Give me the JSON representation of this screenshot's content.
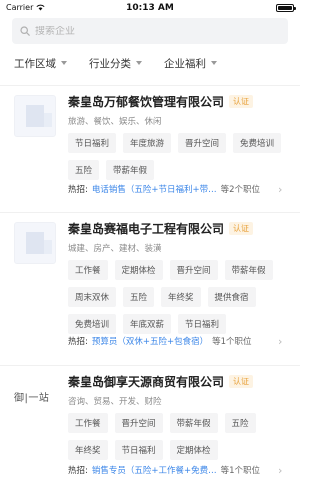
{
  "status_bar": {
    "carrier": "Carrier",
    "time": "10:13 AM"
  },
  "search": {
    "placeholder": "搜索企业"
  },
  "filters": [
    {
      "label": "工作区域"
    },
    {
      "label": "行业分类"
    },
    {
      "label": "企业福利"
    }
  ],
  "companies": [
    {
      "name": "秦皇岛万郁餐饮管理有限公司",
      "cert": "认证",
      "industries": "旅游、餐饮、娱乐、休闲",
      "tags": [
        "节日福利",
        "年度旅游",
        "晋升空间",
        "免费培训",
        "五险",
        "带薪年假"
      ],
      "hot_label": "热招:",
      "hot_job": "电话销售（五险+节日福利+带…",
      "hot_count": "等2个职位"
    },
    {
      "name": "秦皇岛赛福电子工程有限公司",
      "cert": "认证",
      "industries": "城建、房产、建材、装潢",
      "tags": [
        "工作餐",
        "定期体检",
        "晋升空间",
        "带薪年假",
        "周末双休",
        "五险",
        "年终奖",
        "提供食宿",
        "免费培训",
        "年底双薪",
        "节日福利"
      ],
      "hot_label": "热招:",
      "hot_job": "预算员（双休+五险+包食宿）",
      "hot_count": "等1个职位"
    },
    {
      "name": "秦皇岛御享天源商贸有限公司",
      "cert": "认证",
      "logo_text": "御|一站",
      "industries": "咨询、贸易、开发、财险",
      "tags": [
        "工作餐",
        "晋升空间",
        "带薪年假",
        "五险",
        "年终奖",
        "节日福利",
        "定期体检"
      ],
      "hot_label": "热招:",
      "hot_job": "销售专员（五险+工作餐+免费…",
      "hot_count": "等1个职位"
    }
  ]
}
